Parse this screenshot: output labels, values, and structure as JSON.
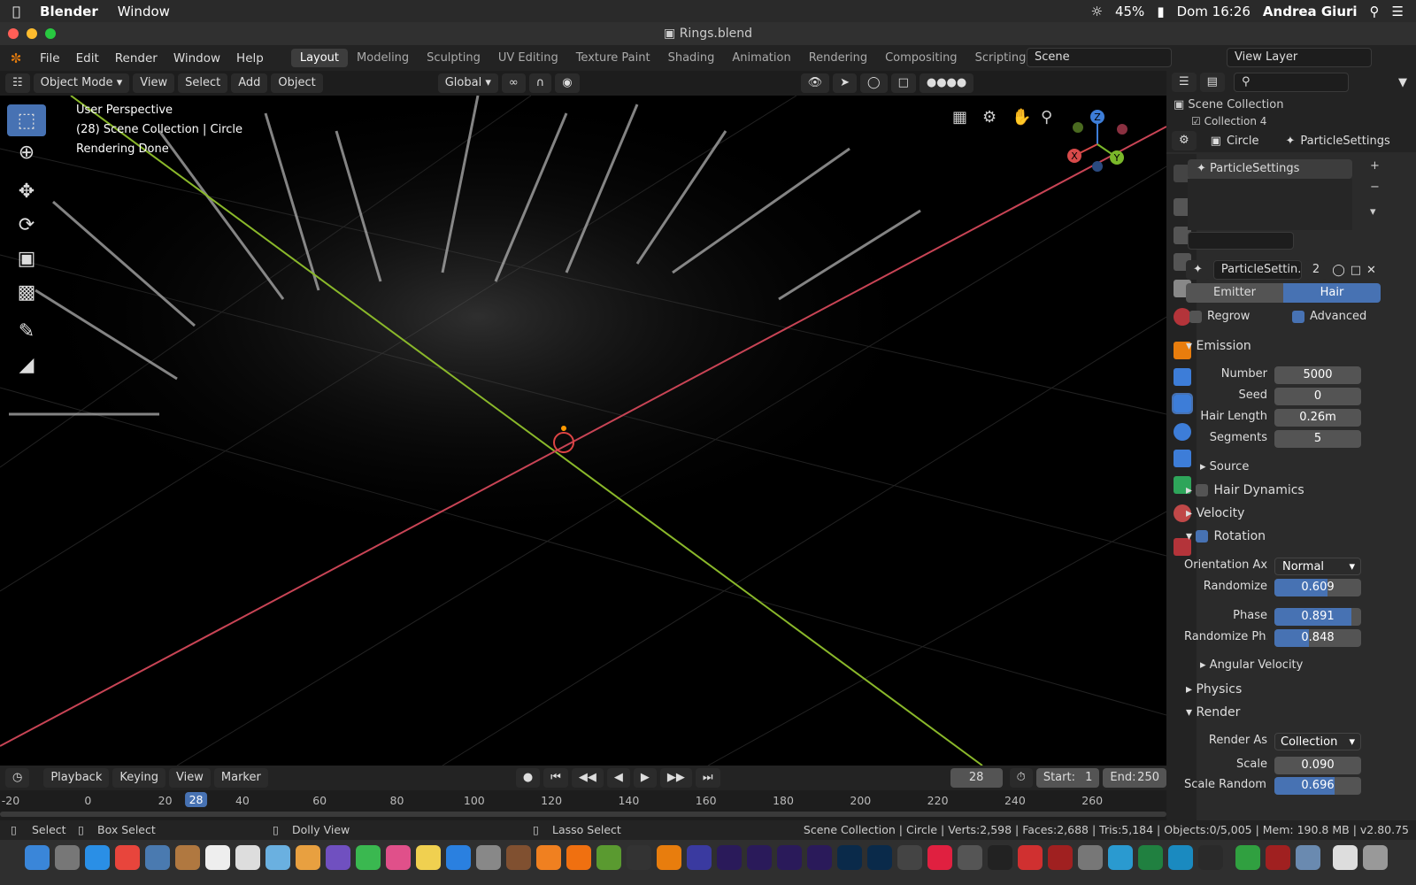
{
  "mac_menu": {
    "app": "Blender",
    "window": "Window",
    "battery": "45%",
    "clock": "Dom 16:26",
    "user": "Andrea Giuri"
  },
  "title": "Rings.blend",
  "menus": [
    "File",
    "Edit",
    "Render",
    "Window",
    "Help"
  ],
  "workspaces": [
    {
      "label": "Layout",
      "active": true
    },
    {
      "label": "Modeling",
      "active": false
    },
    {
      "label": "Sculpting",
      "active": false
    },
    {
      "label": "UV Editing",
      "active": false
    },
    {
      "label": "Texture Paint",
      "active": false
    },
    {
      "label": "Shading",
      "active": false
    },
    {
      "label": "Animation",
      "active": false
    },
    {
      "label": "Rendering",
      "active": false
    },
    {
      "label": "Compositing",
      "active": false
    },
    {
      "label": "Scripting",
      "active": false
    }
  ],
  "scene": "Scene",
  "view_layer": "View Layer",
  "viewport_header": {
    "mode": "Object Mode",
    "menus": [
      "View",
      "Select",
      "Add",
      "Object"
    ],
    "orientation": "Global"
  },
  "overlay_text": [
    "User Perspective",
    "(28) Scene Collection | Circle",
    "Rendering Done"
  ],
  "gizmo": {
    "z": "Z",
    "x": "X",
    "y": "Y"
  },
  "outliner": {
    "root": "Scene Collection",
    "child": "Collection 4"
  },
  "properties": {
    "object": "Circle",
    "particle_system": "ParticleSettings",
    "list_item": "ParticleSettings",
    "settings_name": "ParticleSettin..",
    "users": "2",
    "type_tabs": {
      "emitter": "Emitter",
      "hair": "Hair"
    },
    "regrow": {
      "label": "Regrow",
      "checked": false
    },
    "advanced": {
      "label": "Advanced",
      "checked": true
    },
    "emission": {
      "title": "Emission",
      "fields": [
        {
          "label": "Number",
          "value": "5000"
        },
        {
          "label": "Seed",
          "value": "0"
        },
        {
          "label": "Hair Length",
          "value": "0.26m"
        },
        {
          "label": "Segments",
          "value": "5"
        }
      ],
      "source": "Source"
    },
    "hair_dynamics": "Hair Dynamics",
    "velocity": "Velocity",
    "rotation": {
      "title": "Rotation",
      "orientation_label": "Orientation Axi",
      "orientation_value": "Normal",
      "sliders": [
        {
          "label": "Randomize",
          "value": "0.609",
          "fraction": 0.609
        },
        {
          "label": "Phase",
          "value": "0.891",
          "fraction": 0.891
        },
        {
          "label": "Randomize Ph..",
          "value": "0.848",
          "fraction": 0.4
        }
      ],
      "angular_velocity": "Angular Velocity"
    },
    "physics": "Physics",
    "render": {
      "title": "Render",
      "render_as_label": "Render As",
      "render_as_value": "Collection",
      "scale_label": "Scale",
      "scale_value": "0.090",
      "scale_random_label": "Scale Random..",
      "scale_random_value": "0.696",
      "scale_random_fraction": 0.696
    }
  },
  "timeline": {
    "menus": [
      "Playback",
      "Keying",
      "View",
      "Marker"
    ],
    "current_frame": "28",
    "start_label": "Start:",
    "start": "1",
    "end_label": "End:",
    "end": "250",
    "ruler": [
      "-20",
      "0",
      "20",
      "40",
      "60",
      "80",
      "100",
      "120",
      "140",
      "160",
      "180",
      "200",
      "220",
      "240",
      "260"
    ]
  },
  "status": {
    "select": "Select",
    "box_select": "Box Select",
    "dolly_view": "Dolly View",
    "lasso_select": "Lasso Select",
    "stats": "Scene Collection | Circle | Verts:2,598 | Faces:2,688 | Tris:5,184 | Objects:0/5,005 | Mem: 190.8 MB | v2.80.75"
  }
}
